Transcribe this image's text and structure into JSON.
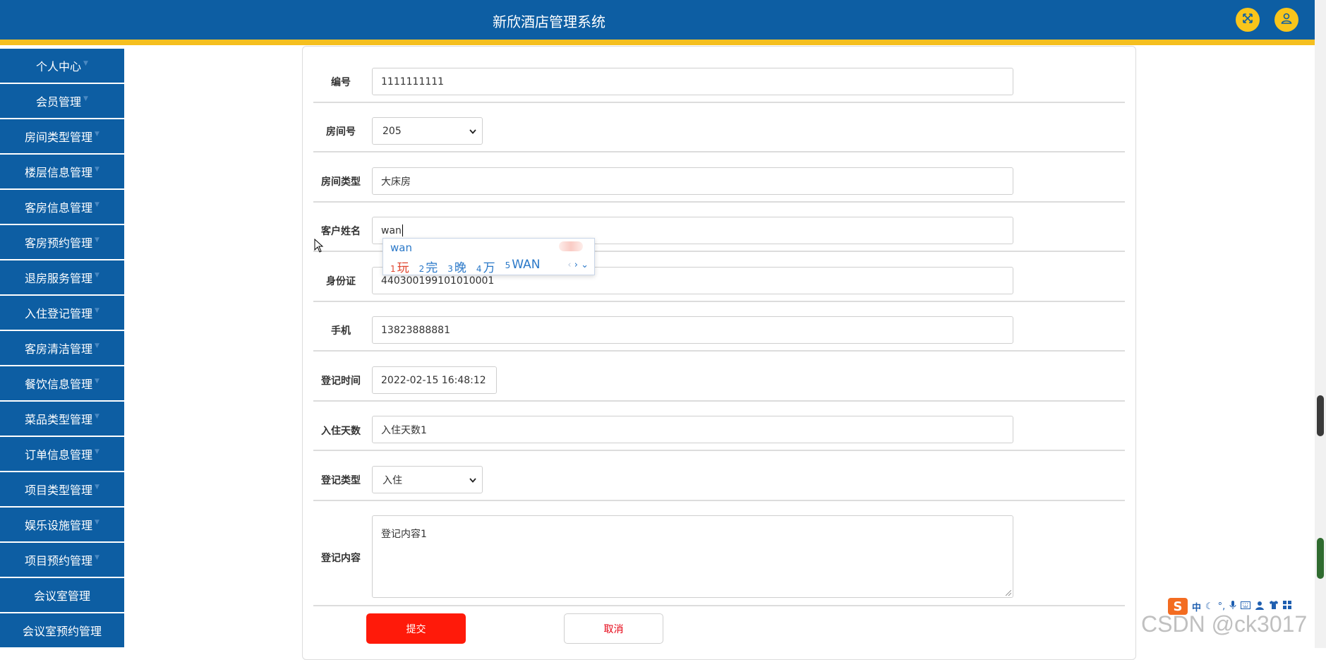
{
  "header": {
    "title": "新欣酒店管理系统",
    "colors": {
      "bar": "#0d5ea3",
      "stripe": "#f5bf1f",
      "button": "#f9c51b"
    },
    "buttons": [
      {
        "icon": "fullscreen-icon"
      },
      {
        "icon": "user-icon"
      }
    ]
  },
  "sidebar": {
    "items": [
      {
        "label": "个人中心"
      },
      {
        "label": "会员管理"
      },
      {
        "label": "房间类型管理"
      },
      {
        "label": "楼层信息管理"
      },
      {
        "label": "客房信息管理"
      },
      {
        "label": "客房预约管理"
      },
      {
        "label": "退房服务管理"
      },
      {
        "label": "入住登记管理"
      },
      {
        "label": "客房清洁管理"
      },
      {
        "label": "餐饮信息管理"
      },
      {
        "label": "菜品类型管理"
      },
      {
        "label": "订单信息管理"
      },
      {
        "label": "项目类型管理"
      },
      {
        "label": "娱乐设施管理"
      },
      {
        "label": "项目预约管理"
      },
      {
        "label": "会议室管理"
      },
      {
        "label": "会议室预约管理"
      }
    ]
  },
  "form": {
    "number": {
      "label": "编号",
      "value": "1111111111"
    },
    "room_no": {
      "label": "房间号",
      "value": "205"
    },
    "room_type": {
      "label": "房间类型",
      "value": "大床房"
    },
    "customer_name": {
      "label": "客户姓名",
      "value": "wan"
    },
    "id_card": {
      "label": "身份证",
      "value": "440300199101010001"
    },
    "phone": {
      "label": "手机",
      "value": "13823888881"
    },
    "checkin_time": {
      "label": "登记时间",
      "value": "2022-02-15 16:48:12"
    },
    "stay_days": {
      "label": "入住天数",
      "value": "入住天数1"
    },
    "reg_type": {
      "label": "登记类型",
      "value": "入住"
    },
    "reg_content": {
      "label": "登记内容",
      "value": "登记内容1"
    },
    "submit_label": "提交",
    "cancel_label": "取消"
  },
  "ime": {
    "composition": "wan",
    "candidates": [
      {
        "num": "1",
        "text": "玩"
      },
      {
        "num": "2",
        "text": "完"
      },
      {
        "num": "3",
        "text": "晚"
      },
      {
        "num": "4",
        "text": "万"
      },
      {
        "num": "5",
        "text": "WAN"
      }
    ]
  },
  "tray": {
    "logo": "S",
    "mode": "中",
    "icons": [
      "moon-icon",
      "punctuation-icon",
      "microphone-icon",
      "keyboard-icon",
      "user-icon",
      "shirt-icon",
      "grid-icon"
    ]
  },
  "watermark": "CSDN @ck3017"
}
